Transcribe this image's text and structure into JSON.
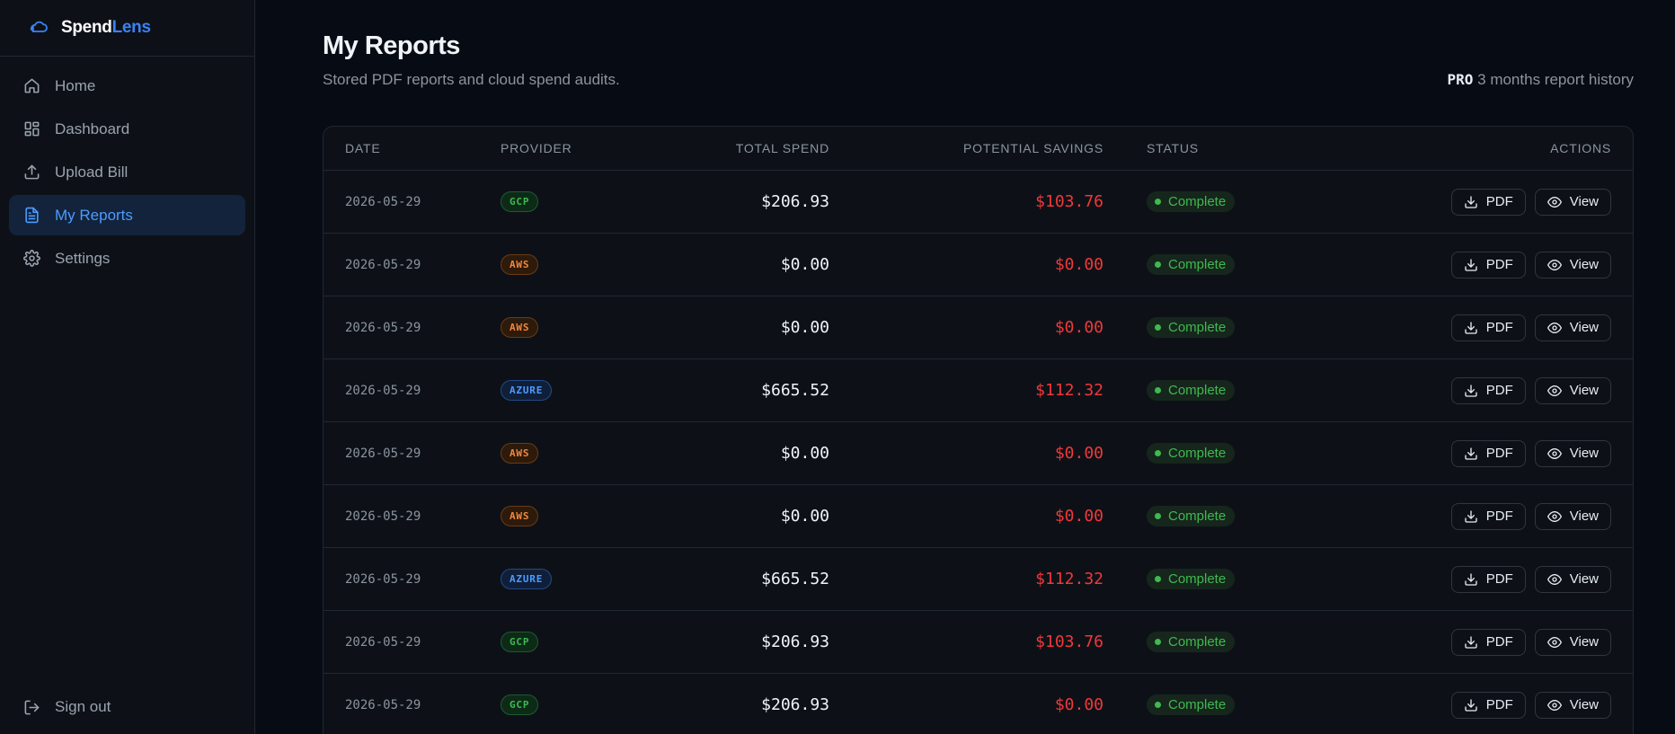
{
  "brand": {
    "name_a": "Spend",
    "name_b": "Lens"
  },
  "nav": [
    {
      "label": "Home",
      "icon": "home-icon",
      "active": false
    },
    {
      "label": "Dashboard",
      "icon": "dashboard-icon",
      "active": false
    },
    {
      "label": "Upload Bill",
      "icon": "upload-icon",
      "active": false
    },
    {
      "label": "My Reports",
      "icon": "file-text-icon",
      "active": true
    },
    {
      "label": "Settings",
      "icon": "gear-icon",
      "active": false
    }
  ],
  "signout": {
    "label": "Sign out",
    "icon": "log-out-icon"
  },
  "page": {
    "title": "My Reports",
    "subtitle": "Stored PDF reports and cloud spend audits.",
    "plan_badge": "PRO",
    "plan_text": "3 months report history"
  },
  "table": {
    "headers": {
      "date": "DATE",
      "provider": "PROVIDER",
      "total_spend": "TOTAL SPEND",
      "potential_savings": "POTENTIAL SAVINGS",
      "status": "STATUS",
      "actions": "ACTIONS"
    },
    "pdf_label": "PDF",
    "view_label": "View",
    "rows": [
      {
        "date": "2026-05-29",
        "provider": "GCP",
        "total_spend": "$206.93",
        "potential_savings": "$103.76",
        "status": "Complete"
      },
      {
        "date": "2026-05-29",
        "provider": "AWS",
        "total_spend": "$0.00",
        "potential_savings": "$0.00",
        "status": "Complete"
      },
      {
        "date": "2026-05-29",
        "provider": "AWS",
        "total_spend": "$0.00",
        "potential_savings": "$0.00",
        "status": "Complete"
      },
      {
        "date": "2026-05-29",
        "provider": "AZURE",
        "total_spend": "$665.52",
        "potential_savings": "$112.32",
        "status": "Complete"
      },
      {
        "date": "2026-05-29",
        "provider": "AWS",
        "total_spend": "$0.00",
        "potential_savings": "$0.00",
        "status": "Complete"
      },
      {
        "date": "2026-05-29",
        "provider": "AWS",
        "total_spend": "$0.00",
        "potential_savings": "$0.00",
        "status": "Complete"
      },
      {
        "date": "2026-05-29",
        "provider": "AZURE",
        "total_spend": "$665.52",
        "potential_savings": "$112.32",
        "status": "Complete"
      },
      {
        "date": "2026-05-29",
        "provider": "GCP",
        "total_spend": "$206.93",
        "potential_savings": "$103.76",
        "status": "Complete"
      },
      {
        "date": "2026-05-29",
        "provider": "GCP",
        "total_spend": "$206.93",
        "potential_savings": "$0.00",
        "status": "Complete"
      }
    ]
  },
  "colors": {
    "accent": "#3b82f6",
    "savings": "#f0383a",
    "complete": "#3fb950",
    "gcp": "#3fb950",
    "aws": "#f0883e",
    "azure": "#4d9bff"
  }
}
